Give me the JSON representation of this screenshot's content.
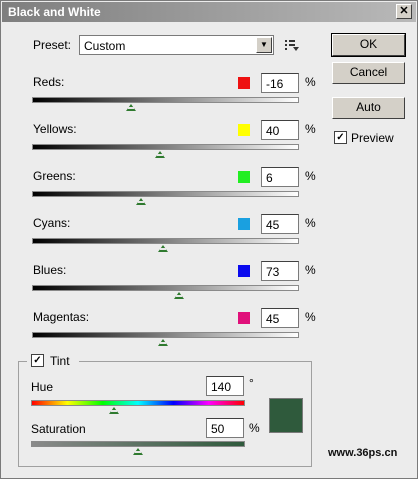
{
  "window": {
    "title": "Black and White",
    "close_glyph": "✕"
  },
  "preset": {
    "label": "Preset:",
    "value": "Custom",
    "menu_icon": "preset-options-icon"
  },
  "channels": [
    {
      "label": "Reds:",
      "value": "-16",
      "unit": "%",
      "color": "#ee1111",
      "slider_fraction": 0.37
    },
    {
      "label": "Yellows:",
      "value": "40",
      "unit": "%",
      "color": "#ffff00",
      "slider_fraction": 0.48
    },
    {
      "label": "Greens:",
      "value": "6",
      "unit": "%",
      "color": "#22ee22",
      "slider_fraction": 0.41
    },
    {
      "label": "Cyans:",
      "value": "45",
      "unit": "%",
      "color": "#1aa0e0",
      "slider_fraction": 0.49
    },
    {
      "label": "Blues:",
      "value": "73",
      "unit": "%",
      "color": "#0a0aee",
      "slider_fraction": 0.55
    },
    {
      "label": "Magentas:",
      "value": "45",
      "unit": "%",
      "color": "#e0107a",
      "slider_fraction": 0.49
    }
  ],
  "buttons": {
    "ok": "OK",
    "cancel": "Cancel",
    "auto": "Auto"
  },
  "preview": {
    "label": "Preview",
    "checked": true
  },
  "tint": {
    "label": "Tint",
    "checked": true,
    "hue_label": "Hue",
    "hue_value": "140",
    "hue_unit": "°",
    "saturation_label": "Saturation",
    "saturation_value": "50",
    "saturation_unit": "%",
    "swatch_color": "#2f5a3c",
    "hue_fraction": 0.39,
    "saturation_fraction": 0.5
  },
  "watermark": "www.36ps.cn"
}
